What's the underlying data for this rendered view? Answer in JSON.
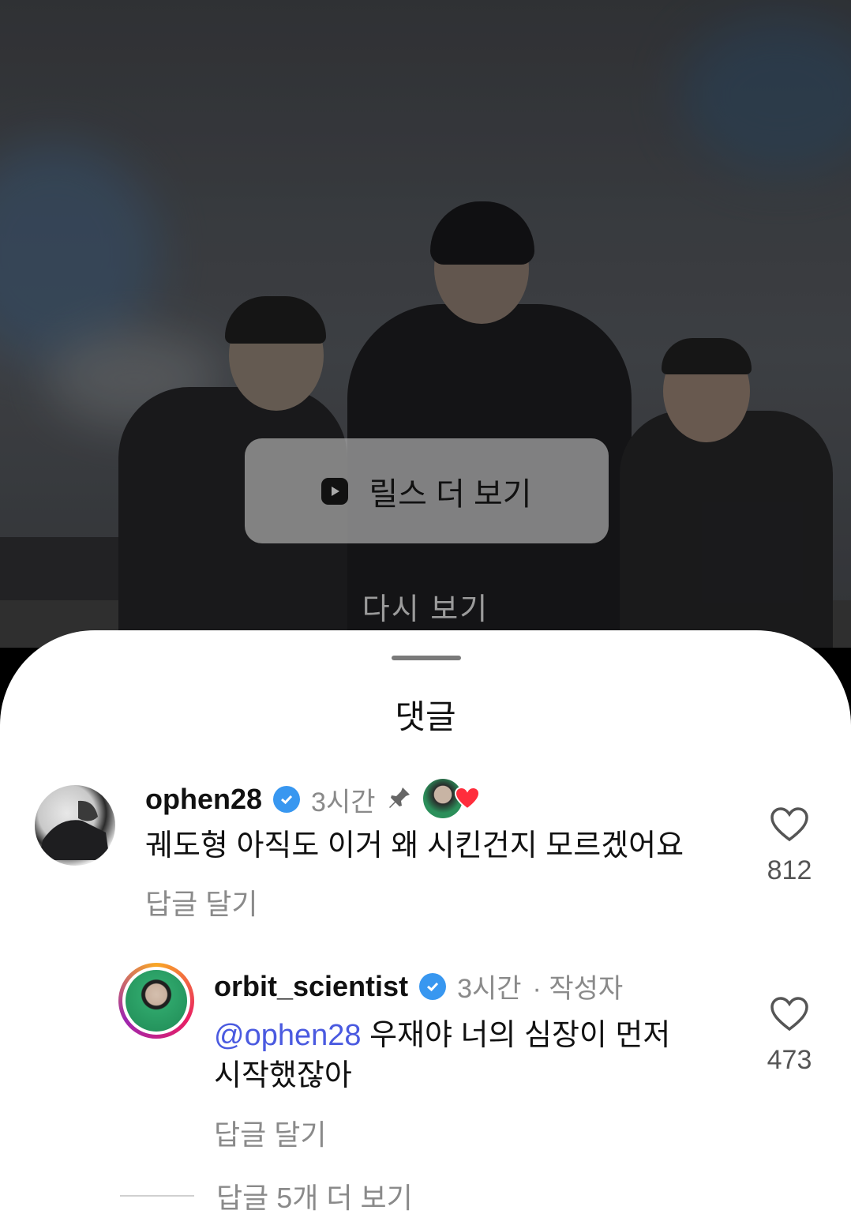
{
  "video": {
    "reels_button_label": "릴스 더 보기",
    "replay_label": "다시 보기"
  },
  "sheet": {
    "title": "댓글"
  },
  "comments": [
    {
      "username": "ophen28",
      "time": "3시간",
      "text": "궤도형 아직도 이거 왜 시킨건지 모르겠어요",
      "reply_label": "답글 달기",
      "likes": "812"
    },
    {
      "username": "orbit_scientist",
      "time": "3시간",
      "author_tag": "· 작성자",
      "mention": "@ophen28",
      "text_line1": " 우재야 너의 심장이 먼저",
      "text_line2": "시작했잖아",
      "reply_label": "답글 달기",
      "likes": "473"
    }
  ],
  "more_replies_label": "답글 5개 더 보기",
  "colors": {
    "verified": "#3897f0",
    "mention": "#4a5ae0",
    "heart_red": "#ff2d3c"
  },
  "icons": [
    "play-icon",
    "verified-icon",
    "pin-icon",
    "heart-icon"
  ]
}
